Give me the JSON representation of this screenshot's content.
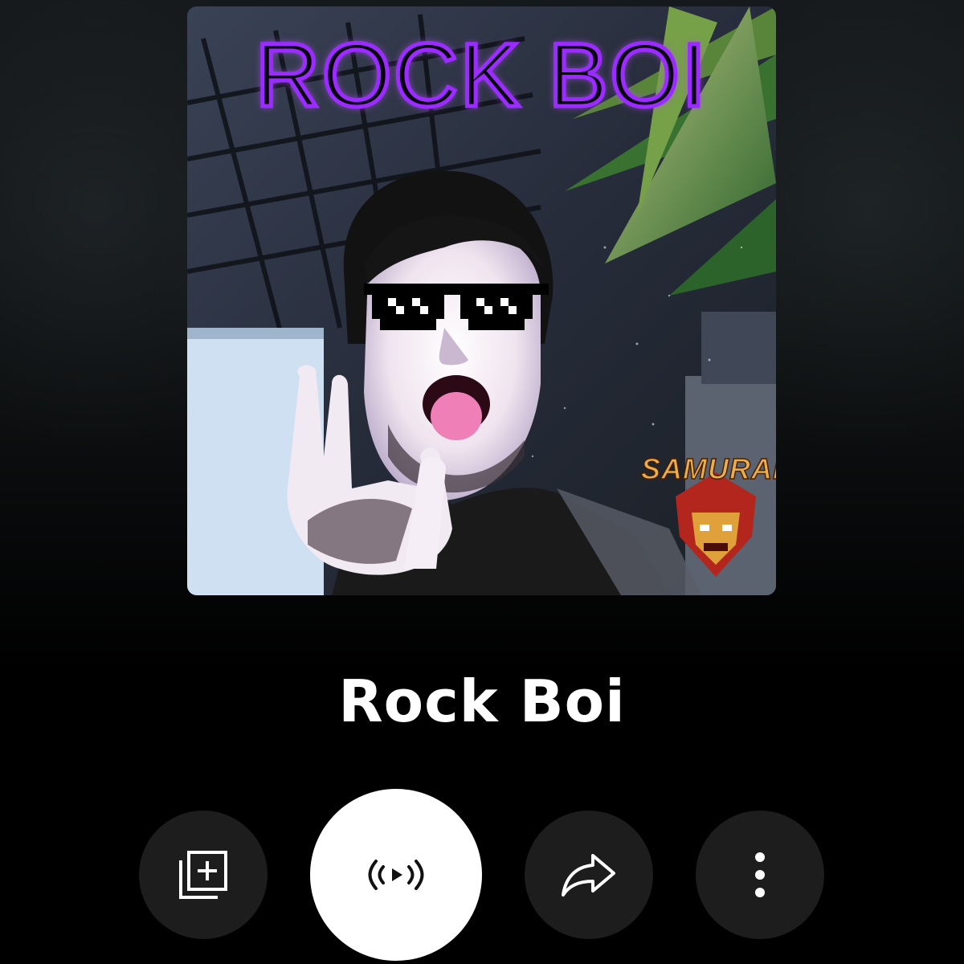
{
  "artwork": {
    "title_text": "ROCK BOI",
    "badge_text": "SAMURAI",
    "title_color": "#9b2cff"
  },
  "track": {
    "title": "Rock Boi"
  },
  "actions": [
    {
      "id": "save",
      "icon": "library-add-icon"
    },
    {
      "id": "radio",
      "icon": "radio-play-icon"
    },
    {
      "id": "share",
      "icon": "share-arrow-icon"
    },
    {
      "id": "more",
      "icon": "more-vertical-icon"
    }
  ],
  "colors": {
    "background": "#000000",
    "button_bg": "#1d1d1d",
    "primary_button_bg": "#ffffff",
    "text": "#ffffff"
  }
}
